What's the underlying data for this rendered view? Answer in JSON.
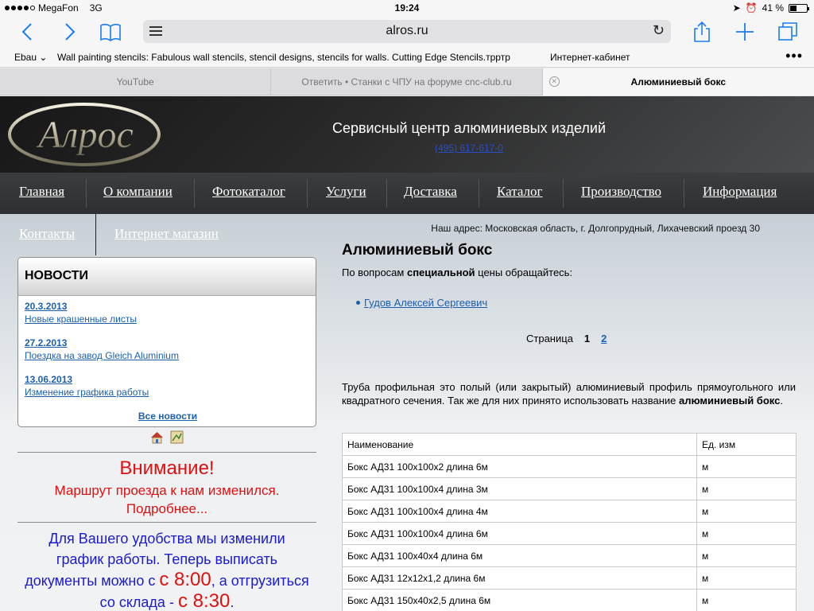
{
  "status_bar": {
    "carrier": "MegaFon",
    "network": "3G",
    "time": "19:24",
    "battery": "41 %",
    "battery_level": 0.41
  },
  "browser": {
    "url": "alros.ru",
    "bookmarks": [
      "Ebau ⌄",
      "Wall painting stencils: Fabulous wall stencils, stencil designs, stencils for walls. Cutting Edge Stencils.трртр",
      "Интернет-кабинет"
    ],
    "tabs": [
      {
        "label": "YouTube",
        "active": false
      },
      {
        "label": "Ответить • Станки с ЧПУ на форуме cnc-club.ru",
        "active": false
      },
      {
        "label": "Алюминиевый бокс",
        "active": true
      }
    ],
    "icons": {
      "back": "chevron-left-icon",
      "forward": "chevron-right-icon",
      "bookmarks": "book-icon",
      "reader": "reader-icon",
      "reload": "reload-icon",
      "share": "share-icon",
      "new_tab": "plus-icon",
      "tabs": "tabs-icon"
    },
    "accent": "#1a7cf5"
  },
  "site": {
    "logo_text": "Алрос",
    "title": "Сервисный центр алюминиевых изделий",
    "phone": "(495) 617-617-0",
    "nav": [
      "Главная",
      "О компании",
      "Фотокаталог",
      "Услуги",
      "Доставка",
      "Каталог",
      "Производство",
      "Информация"
    ],
    "subnav": [
      "Контакты",
      "Интернет магазин"
    ],
    "address": "Наш адрес: Московская область, г. Долгопрудный, Лихачевский проезд 30"
  },
  "news": {
    "heading": "НОВОСТИ",
    "items": [
      {
        "date": "20.3.2013",
        "title": "Новые крашенные листы"
      },
      {
        "date": "27.2.2013",
        "title": "Поездка на завод Gleich Aluminium"
      },
      {
        "date": "13.06.2013",
        "title": "Изменение графика работы"
      }
    ],
    "all_link": "Все новости"
  },
  "notice": {
    "heading": "Внимание!",
    "line1": "Маршрут проезда к нам изменился.",
    "line2": "Подробнее...",
    "blue_1": "Для Вашего удобства мы изменили",
    "blue_2": "график работы. Теперь выписать",
    "blue_3a": "документы можно с ",
    "time1": "с 8:00",
    "blue_3b": ", а отгрузиться",
    "blue_4a": "со склада - ",
    "time2": "с 8:30",
    "blue_4b": "."
  },
  "page": {
    "title": "Алюминиевый бокс",
    "contact_prefix": "По вопросам ",
    "contact_bold": "специальной",
    "contact_suffix": " цены обращайтесь:",
    "contact_person": "Гудов Алексей Сергеевич",
    "pager_label": "Страница",
    "pager_current": "1",
    "pager_next": "2",
    "desc_main": "Труба профильная это полый (или закрытый) алюминиевый профиль прямоугольного или квадратного сечения. Так же для них принято использовать название ",
    "desc_bold": "алюминиевый бокс",
    "desc_end": "."
  },
  "table": {
    "headers": [
      "Наименование",
      "Ед. изм"
    ],
    "rows": [
      [
        "Бокс АД31 100x100x2 длина 6м",
        "м"
      ],
      [
        "Бокс АД31 100x100x4 длина 3м",
        "м"
      ],
      [
        "Бокс АД31 100x100x4 длина 4м",
        "м"
      ],
      [
        "Бокс АД31 100x100x4 длина 6м",
        "м"
      ],
      [
        "Бокс АД31 100x40x4 длина 6м",
        "м"
      ],
      [
        "Бокс АД31 12x12x1,2 длина 6м",
        "м"
      ],
      [
        "Бокс АД31 150x40x2,5 длина 6м",
        "м"
      ]
    ]
  }
}
